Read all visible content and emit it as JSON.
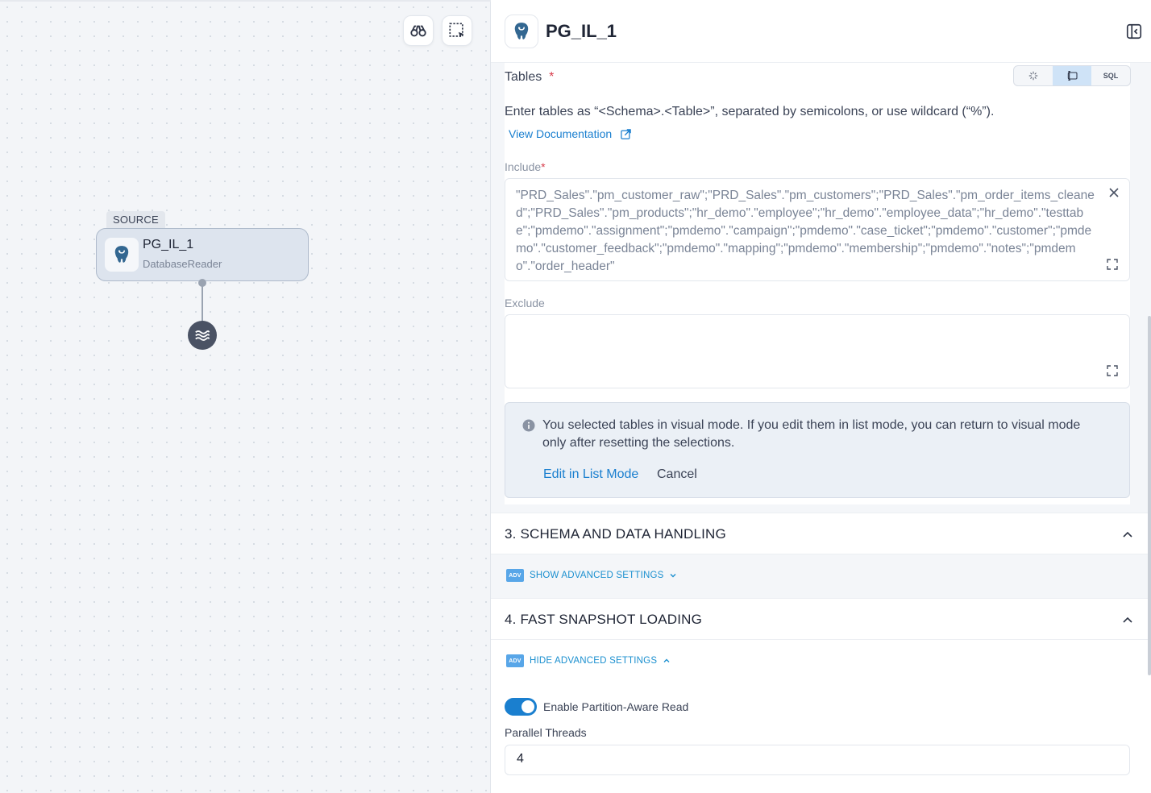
{
  "canvas": {
    "source_tag": "SOURCE",
    "node": {
      "title": "PG_IL_1",
      "subtitle": "DatabaseReader"
    },
    "tools": [
      "binoculars-icon",
      "selection-icon"
    ]
  },
  "panel": {
    "title": "PG_IL_1",
    "tables": {
      "label": "Tables",
      "required_marker": "*",
      "modes": [
        "visual",
        "list",
        "SQL"
      ],
      "active_mode": "list",
      "description": "Enter tables as “<Schema>.<Table>”, separated by semicolons, or use wildcard (“%”).",
      "doc_link": "View Documentation",
      "include_label": "Include",
      "include_value": "\"PRD_Sales\".\"pm_customer_raw\";\"PRD_Sales\".\"pm_customers\";\"PRD_Sales\".\"pm_order_items_cleaned\";\"PRD_Sales\".\"pm_products\";\"hr_demo\".\"employee\";\"hr_demo\".\"employee_data\";\"hr_demo\".\"testtabe\";\"pmdemo\".\"assignment\";\"pmdemo\".\"campaign\";\"pmdemo\".\"case_ticket\";\"pmdemo\".\"customer\";\"pmdemo\".\"customer_feedback\";\"pmdemo\".\"mapping\";\"pmdemo\".\"membership\";\"pmdemo\".\"notes\";\"pmdemo\".\"order_header\"",
      "exclude_label": "Exclude",
      "exclude_value": "",
      "info_text": "You selected tables in visual mode. If you edit them in list mode, you can return to visual mode only after resetting the selections.",
      "edit_button": "Edit in List Mode",
      "cancel_button": "Cancel"
    },
    "section3": {
      "title": "3. SCHEMA AND DATA HANDLING",
      "adv_badge": "ADV",
      "adv_toggle": "SHOW ADVANCED SETTINGS"
    },
    "section4": {
      "title": "4. FAST SNAPSHOT LOADING",
      "adv_badge": "ADV",
      "adv_toggle": "HIDE ADVANCED SETTINGS",
      "partition_label": "Enable Partition-Aware Read",
      "partition_enabled": true,
      "threads_label": "Parallel Threads",
      "threads_value": "4"
    }
  },
  "colors": {
    "accent": "#1a7fcf",
    "toggle_on": "#1a7fcf",
    "active_mode_bg": "#cfe3f7"
  }
}
